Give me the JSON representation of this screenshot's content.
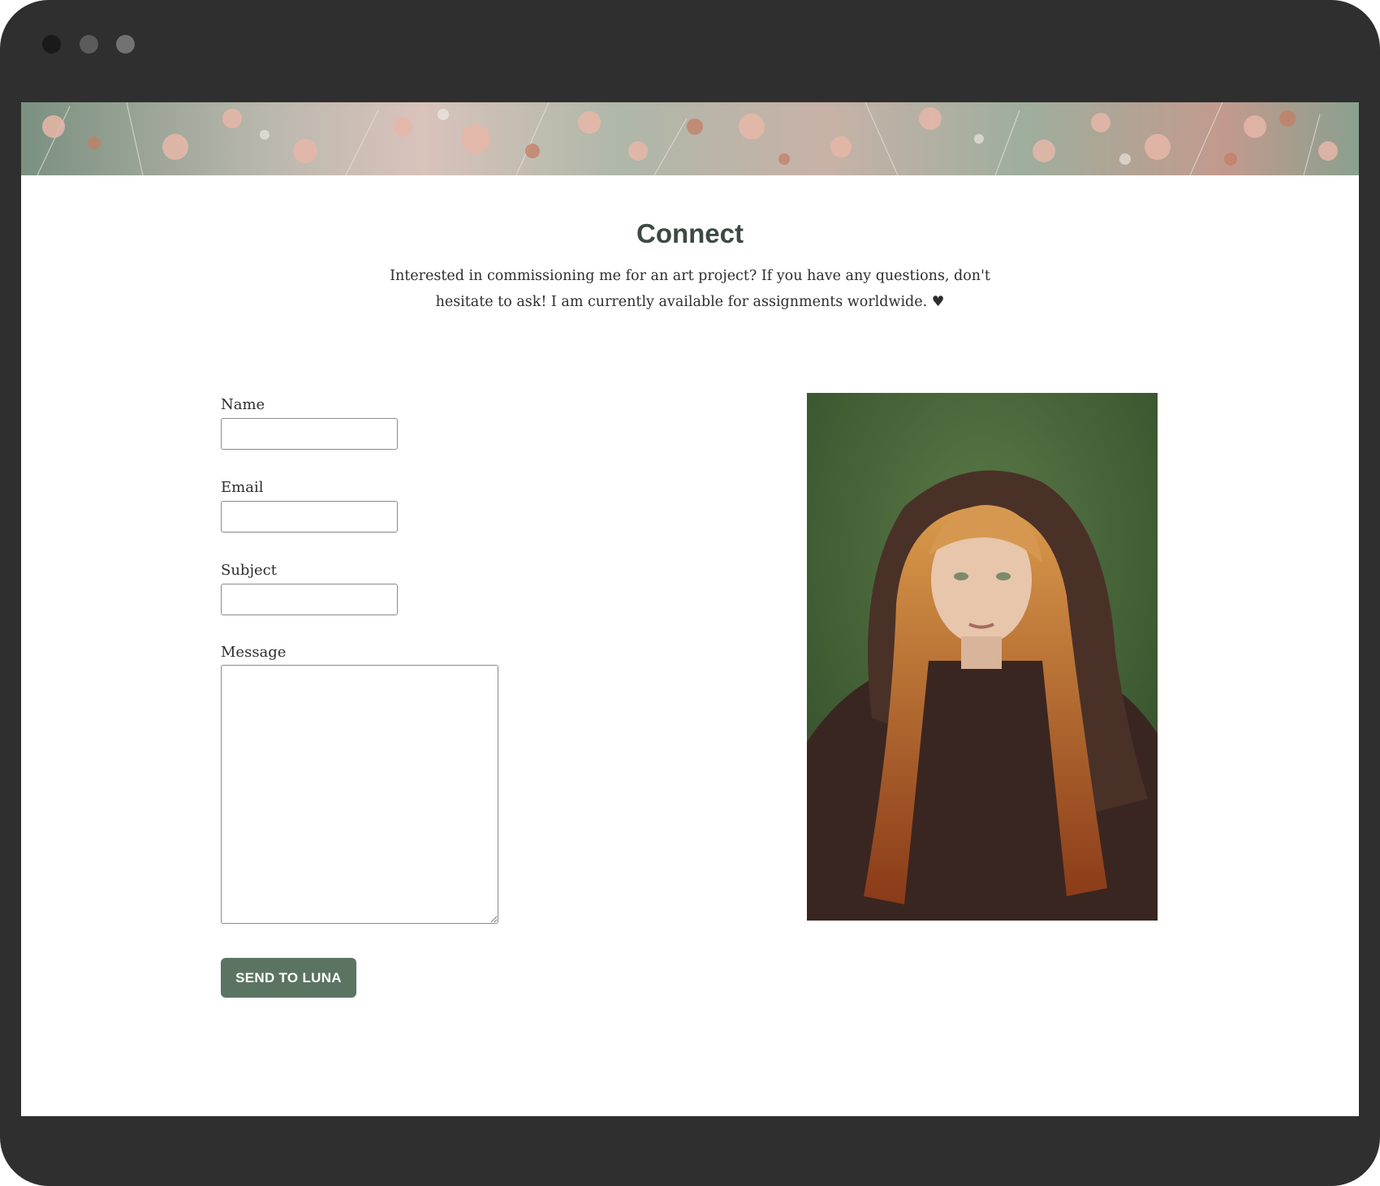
{
  "banner": {
    "image_icon": "meadow-grass-banner"
  },
  "contact": {
    "title": "Connect",
    "intro": "Interested in commissioning me for an art project? If you have any questions, don't hesitate to ask! I am currently available for assignments worldwide. ♥"
  },
  "form": {
    "name_label": "Name",
    "name_value": "",
    "email_label": "Email",
    "email_value": "",
    "subject_label": "Subject",
    "subject_value": "",
    "message_label": "Message",
    "message_value": "",
    "submit_label": "SEND TO LUNA"
  },
  "portrait": {
    "image_icon": "hooded-portrait-photo"
  },
  "colors": {
    "frame": "#2f2f2f",
    "heading": "#3d4a43",
    "button": "#5b7462",
    "button_text": "#ffffff"
  }
}
